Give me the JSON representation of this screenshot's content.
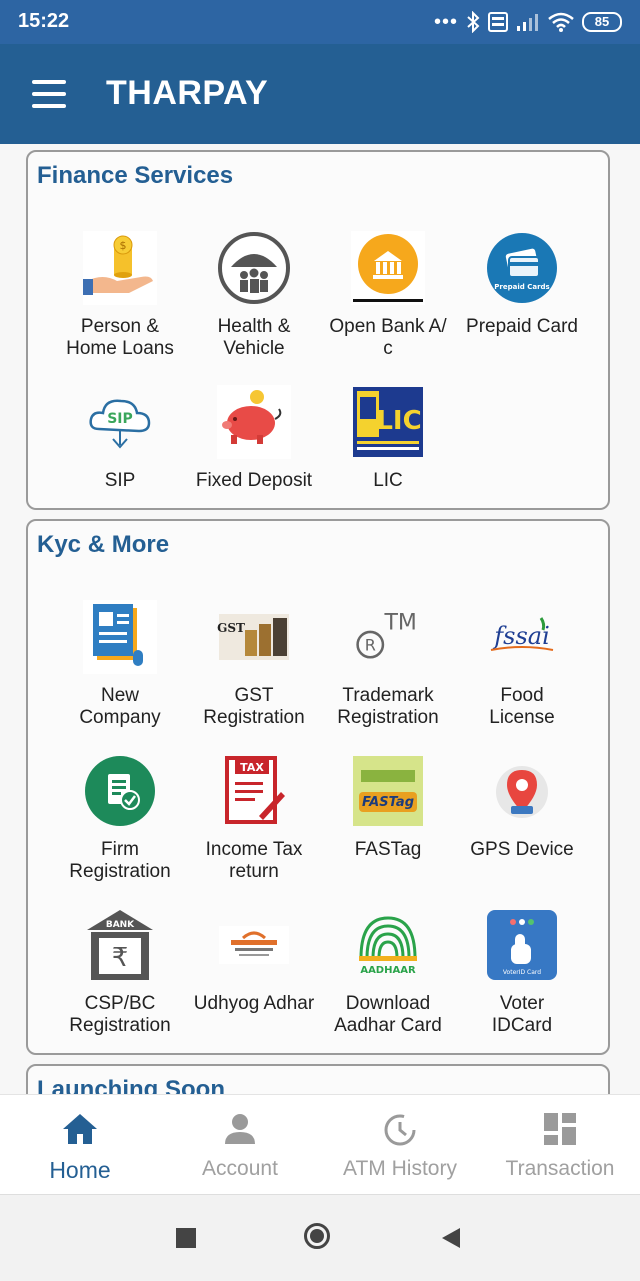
{
  "status_bar": {
    "time": "15:22",
    "dots": "•••",
    "battery": "85",
    "icons": [
      "bluetooth-icon",
      "volte-icon",
      "signal-icon",
      "wifi-icon",
      "battery-icon"
    ]
  },
  "app_bar": {
    "title": "THARPAY",
    "menu_icon": "hamburger-menu-icon"
  },
  "finance": {
    "title": "Finance Services",
    "items": [
      {
        "label": "Person & Home Loans",
        "line1": "Person &",
        "line2": "Home Loans",
        "icon": "hand-coins-icon"
      },
      {
        "label": "Health & Vehicle",
        "line1": "Health &",
        "line2": "Vehicle",
        "icon": "umbrella-family-icon"
      },
      {
        "label": "Open Bank A/c",
        "line1": "Open Bank A/",
        "line2": "c",
        "icon": "bank-building-icon"
      },
      {
        "label": "Prepaid Card",
        "line1": "Prepaid Card",
        "line2": "",
        "icon": "prepaid-card-icon",
        "badge": "Prepaid Cards"
      },
      {
        "label": "SIP",
        "line1": "SIP",
        "line2": "",
        "icon": "sip-cloud-icon",
        "badge": "SIP"
      },
      {
        "label": "Fixed Deposit",
        "line1": "Fixed Deposit",
        "line2": "",
        "icon": "piggy-bank-icon"
      },
      {
        "label": "LIC",
        "line1": "LIC",
        "line2": "",
        "icon": "lic-logo-icon",
        "badge": "LIC"
      }
    ]
  },
  "kyc": {
    "title": "Kyc & More",
    "items": [
      {
        "label": "New Company",
        "line1": "New",
        "line2": "Company",
        "icon": "company-document-icon"
      },
      {
        "label": "GST Registration",
        "line1": "GST",
        "line2": "Registration",
        "icon": "gst-coins-icon",
        "badge": "GST"
      },
      {
        "label": "Trademark Registration",
        "line1": "Trademark",
        "line2": "Registration",
        "icon": "trademark-icon",
        "badge": "®TM"
      },
      {
        "label": "Food License",
        "line1": "Food",
        "line2": "License",
        "icon": "fssai-logo-icon",
        "badge": "fssai"
      },
      {
        "label": "Firm Registration",
        "line1": "Firm",
        "line2": "Registration",
        "icon": "firm-document-check-icon"
      },
      {
        "label": "Income Tax return",
        "line1": "Income Tax",
        "line2": "return",
        "icon": "tax-form-icon",
        "badge": "TAX"
      },
      {
        "label": "FASTag",
        "line1": "FASTag",
        "line2": "",
        "icon": "fastag-icon",
        "badge": "FASTag"
      },
      {
        "label": "GPS Device",
        "line1": "GPS Device",
        "line2": "",
        "icon": "gps-pin-icon"
      },
      {
        "label": "CSP/BC Registration",
        "line1": "CSP/BC",
        "line2": "Registration",
        "icon": "bank-rupee-icon",
        "badge": "BANK"
      },
      {
        "label": "Udhyog Adhar",
        "line1": "Udhyog Adhar",
        "line2": "",
        "icon": "udhyog-aadhaar-logo-icon"
      },
      {
        "label": "Download Aadhar Card",
        "line1": "Download",
        "line2": "Aadhar Card",
        "icon": "aadhaar-logo-icon",
        "badge": "AADHAAR"
      },
      {
        "label": "Voter IDCard",
        "line1": "Voter",
        "line2": "IDCard",
        "icon": "voter-id-card-icon",
        "badge": "VoterID Card"
      }
    ]
  },
  "launching": {
    "title": "Launching Soon"
  },
  "bottom_nav": [
    {
      "label": "Home",
      "icon": "home-icon",
      "active": true
    },
    {
      "label": "Account",
      "icon": "person-icon",
      "active": false
    },
    {
      "label": "ATM History",
      "icon": "history-clock-icon",
      "active": false
    },
    {
      "label": "Transaction",
      "icon": "dashboard-grid-icon",
      "active": false
    }
  ],
  "system_nav": [
    "recent-apps-square-icon",
    "home-circle-icon",
    "back-triangle-icon"
  ],
  "colors": {
    "primary": "#245f93",
    "status_bar": "#2d65a3",
    "inactive": "#a0a0a0"
  }
}
